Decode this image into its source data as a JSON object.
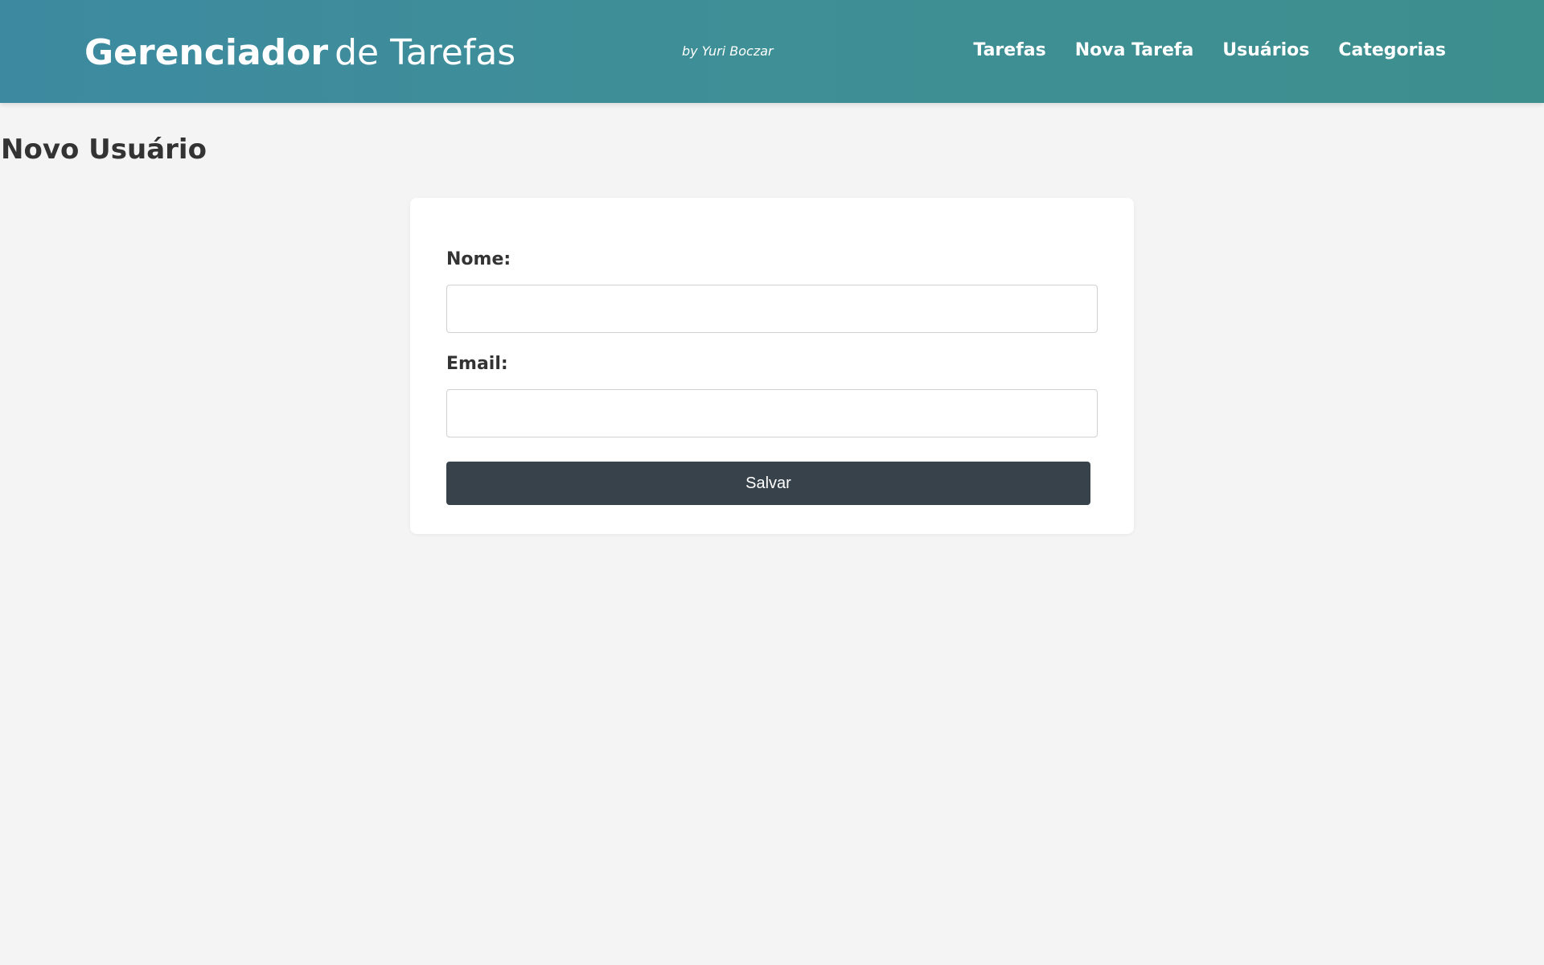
{
  "header": {
    "brand_bold": "Gerenciador",
    "brand_light": "de Tarefas",
    "byline": "by Yuri Boczar",
    "nav": [
      {
        "label": "Tarefas"
      },
      {
        "label": "Nova Tarefa"
      },
      {
        "label": "Usuários"
      },
      {
        "label": "Categorias"
      }
    ]
  },
  "page": {
    "title": "Novo Usuário"
  },
  "form": {
    "name_label": "Nome:",
    "name_value": "",
    "email_label": "Email:",
    "email_value": "",
    "save_label": "Salvar"
  },
  "colors": {
    "header_start": "#3d8aa0",
    "header_end": "#3d8f8e",
    "button": "#37424b",
    "background": "#f4f4f4"
  }
}
